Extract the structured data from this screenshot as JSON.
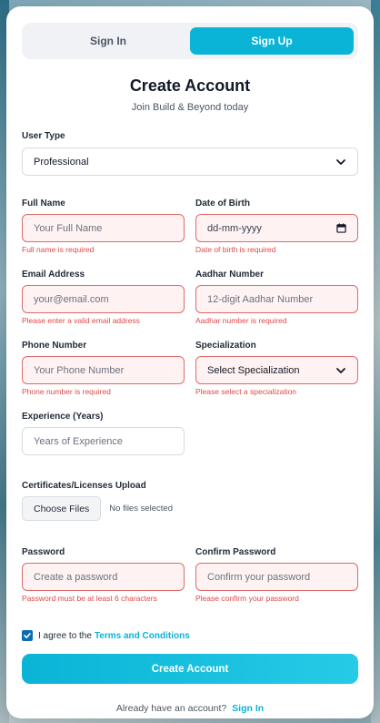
{
  "tabs": {
    "sign_in": "Sign In",
    "sign_up": "Sign Up"
  },
  "header": {
    "title": "Create Account",
    "subtitle": "Join Build & Beyond today"
  },
  "user_type": {
    "label": "User Type",
    "value": "Professional"
  },
  "full_name": {
    "label": "Full Name",
    "placeholder": "Your Full Name",
    "error": "Full name is required"
  },
  "dob": {
    "label": "Date of Birth",
    "placeholder": "dd-mm-yyyy",
    "error": "Date of birth is required"
  },
  "email": {
    "label": "Email Address",
    "placeholder": "your@email.com",
    "error": "Please enter a valid email address"
  },
  "aadhar": {
    "label": "Aadhar Number",
    "placeholder": "12-digit Aadhar Number",
    "error": "Aadhar number is required"
  },
  "phone": {
    "label": "Phone Number",
    "placeholder": "Your Phone Number",
    "error": "Phone number is required"
  },
  "specialization": {
    "label": "Specialization",
    "value": "Select Specialization",
    "error": "Please select a specialization"
  },
  "experience": {
    "label": "Experience (Years)",
    "placeholder": "Years of Experience"
  },
  "upload": {
    "label": "Certificates/Licenses Upload",
    "button": "Choose Files",
    "status": "No files selected"
  },
  "password": {
    "label": "Password",
    "placeholder": "Create a password",
    "error": "Password must be at least 6 characters"
  },
  "confirm_password": {
    "label": "Confirm Password",
    "placeholder": "Confirm your password",
    "error": "Please confirm your password"
  },
  "terms": {
    "text": "I agree to the",
    "link": "Terms and Conditions",
    "checked": true
  },
  "submit": {
    "label": "Create Account"
  },
  "footer": {
    "text": "Already have an account?",
    "link": "Sign In"
  },
  "colors": {
    "accent": "#0ab4d6",
    "error": "#e04848",
    "error_bg": "#fff2f2"
  }
}
